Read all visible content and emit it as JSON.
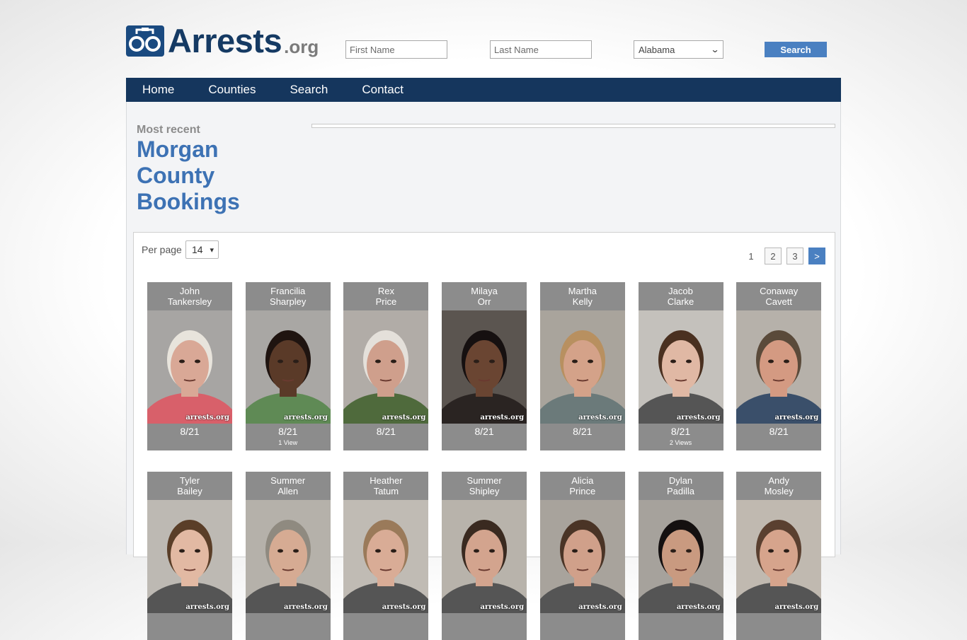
{
  "header": {
    "logo_text": "Arrests",
    "logo_suffix": ".org",
    "first_name_placeholder": "First Name",
    "last_name_placeholder": "Last Name",
    "state_selected": "Alabama",
    "search_label": "Search"
  },
  "nav": {
    "items": [
      "Home",
      "Counties",
      "Search",
      "Contact"
    ]
  },
  "main": {
    "subtitle": "Most recent",
    "title_lines": [
      "Morgan",
      "County",
      "Bookings"
    ]
  },
  "listing": {
    "per_page_label": "Per page",
    "per_page_value": "14",
    "pagination": {
      "current": "1",
      "pages": [
        "2",
        "3"
      ],
      "next": ">"
    },
    "watermark": "arrests.org",
    "bookings": [
      {
        "first": "John",
        "last": "Tankersley",
        "date": "8/21",
        "views": "",
        "skin": "#d9a896",
        "hair": "#e8e4dc",
        "bg": "#a7a5a3",
        "shirt": "#d8606a"
      },
      {
        "first": "Francilia",
        "last": "Sharpley",
        "date": "8/21",
        "views": "1 View",
        "skin": "#5a3a28",
        "hair": "#1f1410",
        "bg": "#a9a7a4",
        "shirt": "#5f8a55"
      },
      {
        "first": "Rex",
        "last": "Price",
        "date": "8/21",
        "views": "",
        "skin": "#cf9f8c",
        "hair": "#e4e0da",
        "bg": "#b1aca7",
        "shirt": "#4f6a3c"
      },
      {
        "first": "Milaya",
        "last": "Orr",
        "date": "8/21",
        "views": "",
        "skin": "#6a4532",
        "hair": "#161010",
        "bg": "#5b5550",
        "shirt": "#2a2422"
      },
      {
        "first": "Martha",
        "last": "Kelly",
        "date": "8/21",
        "views": "",
        "skin": "#d4a289",
        "hair": "#b89060",
        "bg": "#a9a49c",
        "shirt": "#6b7a7a"
      },
      {
        "first": "Jacob",
        "last": "Clarke",
        "date": "8/21",
        "views": "2 Views",
        "skin": "#e0b8a4",
        "hair": "#4a3020",
        "bg": "#c4c1bc",
        "shirt": "#555555"
      },
      {
        "first": "Conaway",
        "last": "Cavett",
        "date": "8/21",
        "views": "",
        "skin": "#d49a82",
        "hair": "#5a4a3a",
        "bg": "#b6b1aa",
        "shirt": "#3a4f6a"
      },
      {
        "first": "Tyler",
        "last": "Bailey",
        "date": "",
        "views": "",
        "skin": "#e2b9a3",
        "hair": "#5a3e28",
        "bg": "#bdb9b3",
        "shirt": "#555555"
      },
      {
        "first": "Summer",
        "last": "Allen",
        "date": "",
        "views": "",
        "skin": "#d6ab93",
        "hair": "#8f8a80",
        "bg": "#b5b1aa",
        "shirt": "#555555"
      },
      {
        "first": "Heather",
        "last": "Tatum",
        "date": "",
        "views": "",
        "skin": "#d9ac96",
        "hair": "#9a7a5a",
        "bg": "#c0bbb4",
        "shirt": "#555555"
      },
      {
        "first": "Summer",
        "last": "Shipley",
        "date": "",
        "views": "",
        "skin": "#d3a48e",
        "hair": "#3a2a20",
        "bg": "#b8b3ab",
        "shirt": "#555555"
      },
      {
        "first": "Alicia",
        "last": "Prince",
        "date": "",
        "views": "",
        "skin": "#d0a08a",
        "hair": "#4a3426",
        "bg": "#a8a39c",
        "shirt": "#555555"
      },
      {
        "first": "Dylan",
        "last": "Padilla",
        "date": "",
        "views": "",
        "skin": "#c99a80",
        "hair": "#141010",
        "bg": "#a6a29c",
        "shirt": "#555555"
      },
      {
        "first": "Andy",
        "last": "Mosley",
        "date": "",
        "views": "",
        "skin": "#d6a48c",
        "hair": "#5a4030",
        "bg": "#c0b9b0",
        "shirt": "#555555"
      }
    ]
  }
}
